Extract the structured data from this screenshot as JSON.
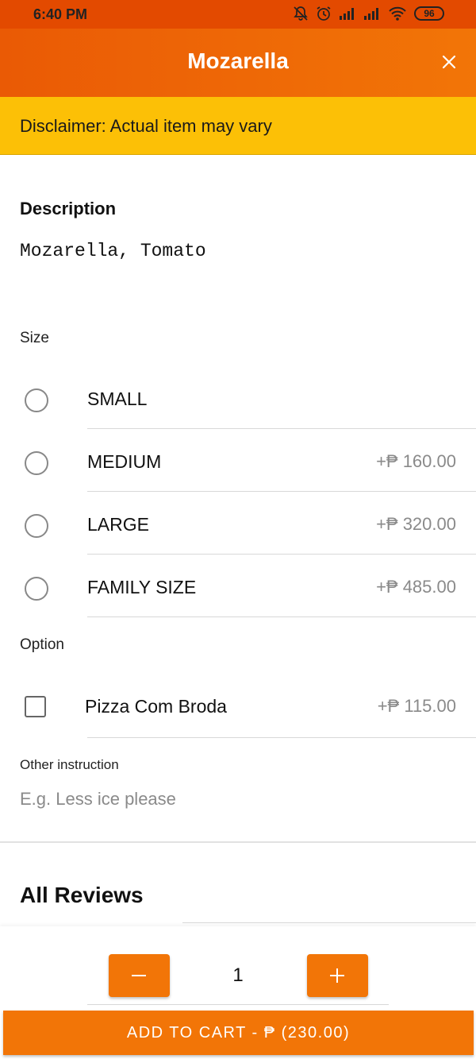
{
  "status_bar": {
    "time": "6:40 PM",
    "battery": "96"
  },
  "header": {
    "title": "Mozarella"
  },
  "disclaimer": "Disclaimer: Actual item may vary",
  "description": {
    "heading": "Description",
    "text": "Mozarella, Tomato"
  },
  "size": {
    "label": "Size",
    "options": [
      {
        "label": "SMALL",
        "price": ""
      },
      {
        "label": "MEDIUM",
        "price": "+₱ 160.00"
      },
      {
        "label": "LARGE",
        "price": "+₱ 320.00"
      },
      {
        "label": "FAMILY SIZE",
        "price": "+₱ 485.00"
      }
    ]
  },
  "option": {
    "label": "Option",
    "items": [
      {
        "label": "Pizza Com Broda",
        "price": "+₱ 115.00"
      }
    ]
  },
  "other_instruction": {
    "label": "Other instruction",
    "placeholder": "E.g. Less ice please",
    "value": ""
  },
  "reviews": {
    "heading": "All Reviews"
  },
  "quantity": {
    "value": "1"
  },
  "cart": {
    "button_label": "ADD TO CART - ₱ (230.00)"
  },
  "colors": {
    "accent": "#f27507",
    "status_bar": "#e34a00",
    "disclaimer_bg": "#fcc006"
  }
}
